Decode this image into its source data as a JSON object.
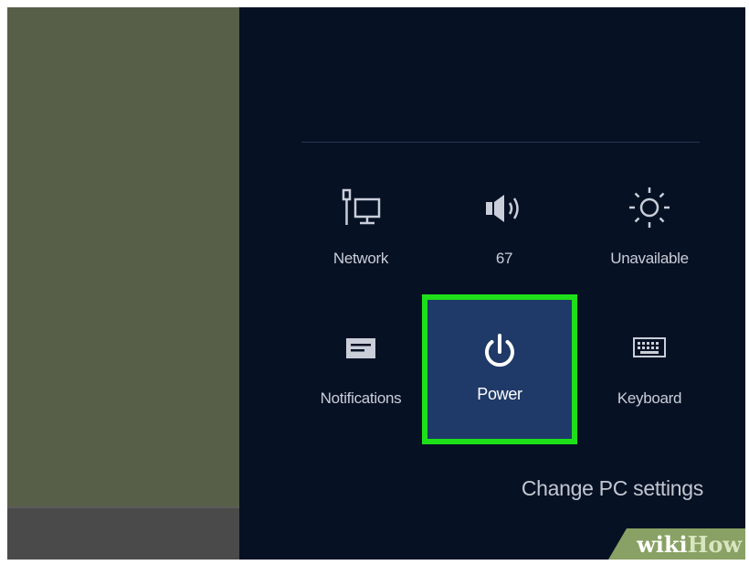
{
  "settings_charm": {
    "tiles": [
      {
        "label": "Network",
        "icon": "network-icon"
      },
      {
        "label": "67",
        "icon": "volume-icon"
      },
      {
        "label": "Unavailable",
        "icon": "brightness-icon"
      },
      {
        "label": "Notifications",
        "icon": "notifications-icon"
      },
      {
        "label": "Power",
        "icon": "power-icon"
      },
      {
        "label": "Keyboard",
        "icon": "keyboard-icon"
      }
    ],
    "change_settings_label": "Change PC settings"
  },
  "watermark": {
    "part1": "wiki",
    "part2": "How"
  },
  "colors": {
    "panel_bg": "#061124",
    "desktop_bg": "#575f48",
    "power_tile_bg": "#1f3a68",
    "highlight": "#1ee01a"
  }
}
